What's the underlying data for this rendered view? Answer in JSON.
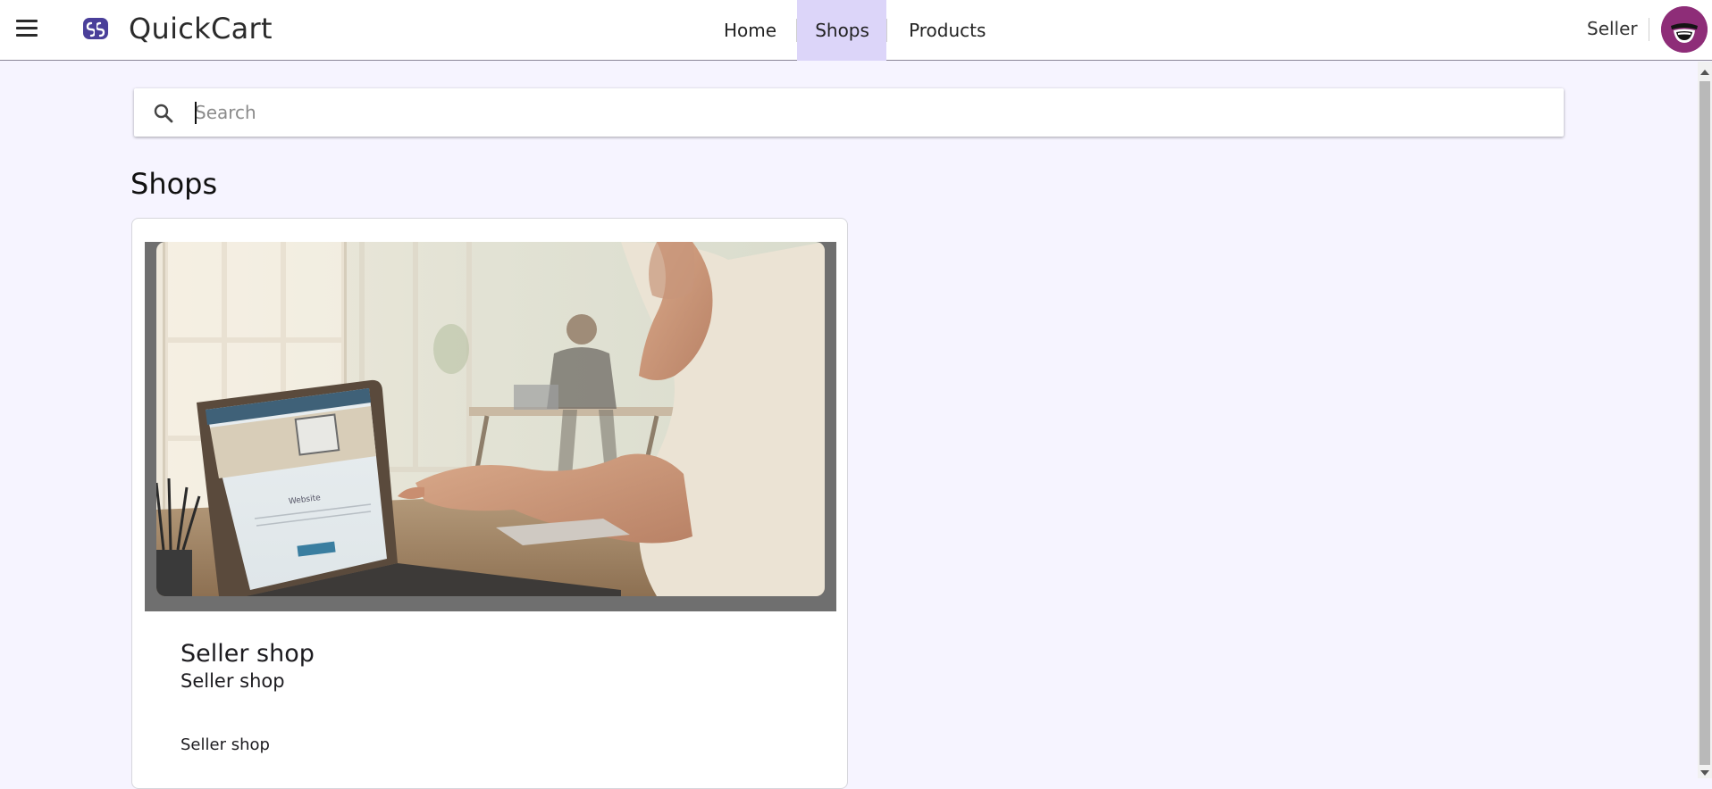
{
  "header": {
    "app_title": "QuickCart",
    "logo": "quickcart-logo-icon",
    "menu_icon": "hamburger-menu-icon",
    "nav": [
      {
        "label": "Home",
        "active": false
      },
      {
        "label": "Shops",
        "active": true
      },
      {
        "label": "Products",
        "active": false
      }
    ],
    "user_label": "Seller",
    "avatar": "avatar-icon"
  },
  "search": {
    "placeholder": "Search",
    "value": "",
    "icon": "search-icon"
  },
  "main": {
    "title": "Shops",
    "shops": [
      {
        "name": "Seller shop",
        "subtitle": "Seller shop",
        "description": "Seller shop",
        "image": "shop-banner-laptop-photo"
      }
    ]
  },
  "colors": {
    "accent": "#dcd5f9",
    "background": "#f6f4ff",
    "logo": "#4a3f9a",
    "avatar": "#8e2d78"
  }
}
